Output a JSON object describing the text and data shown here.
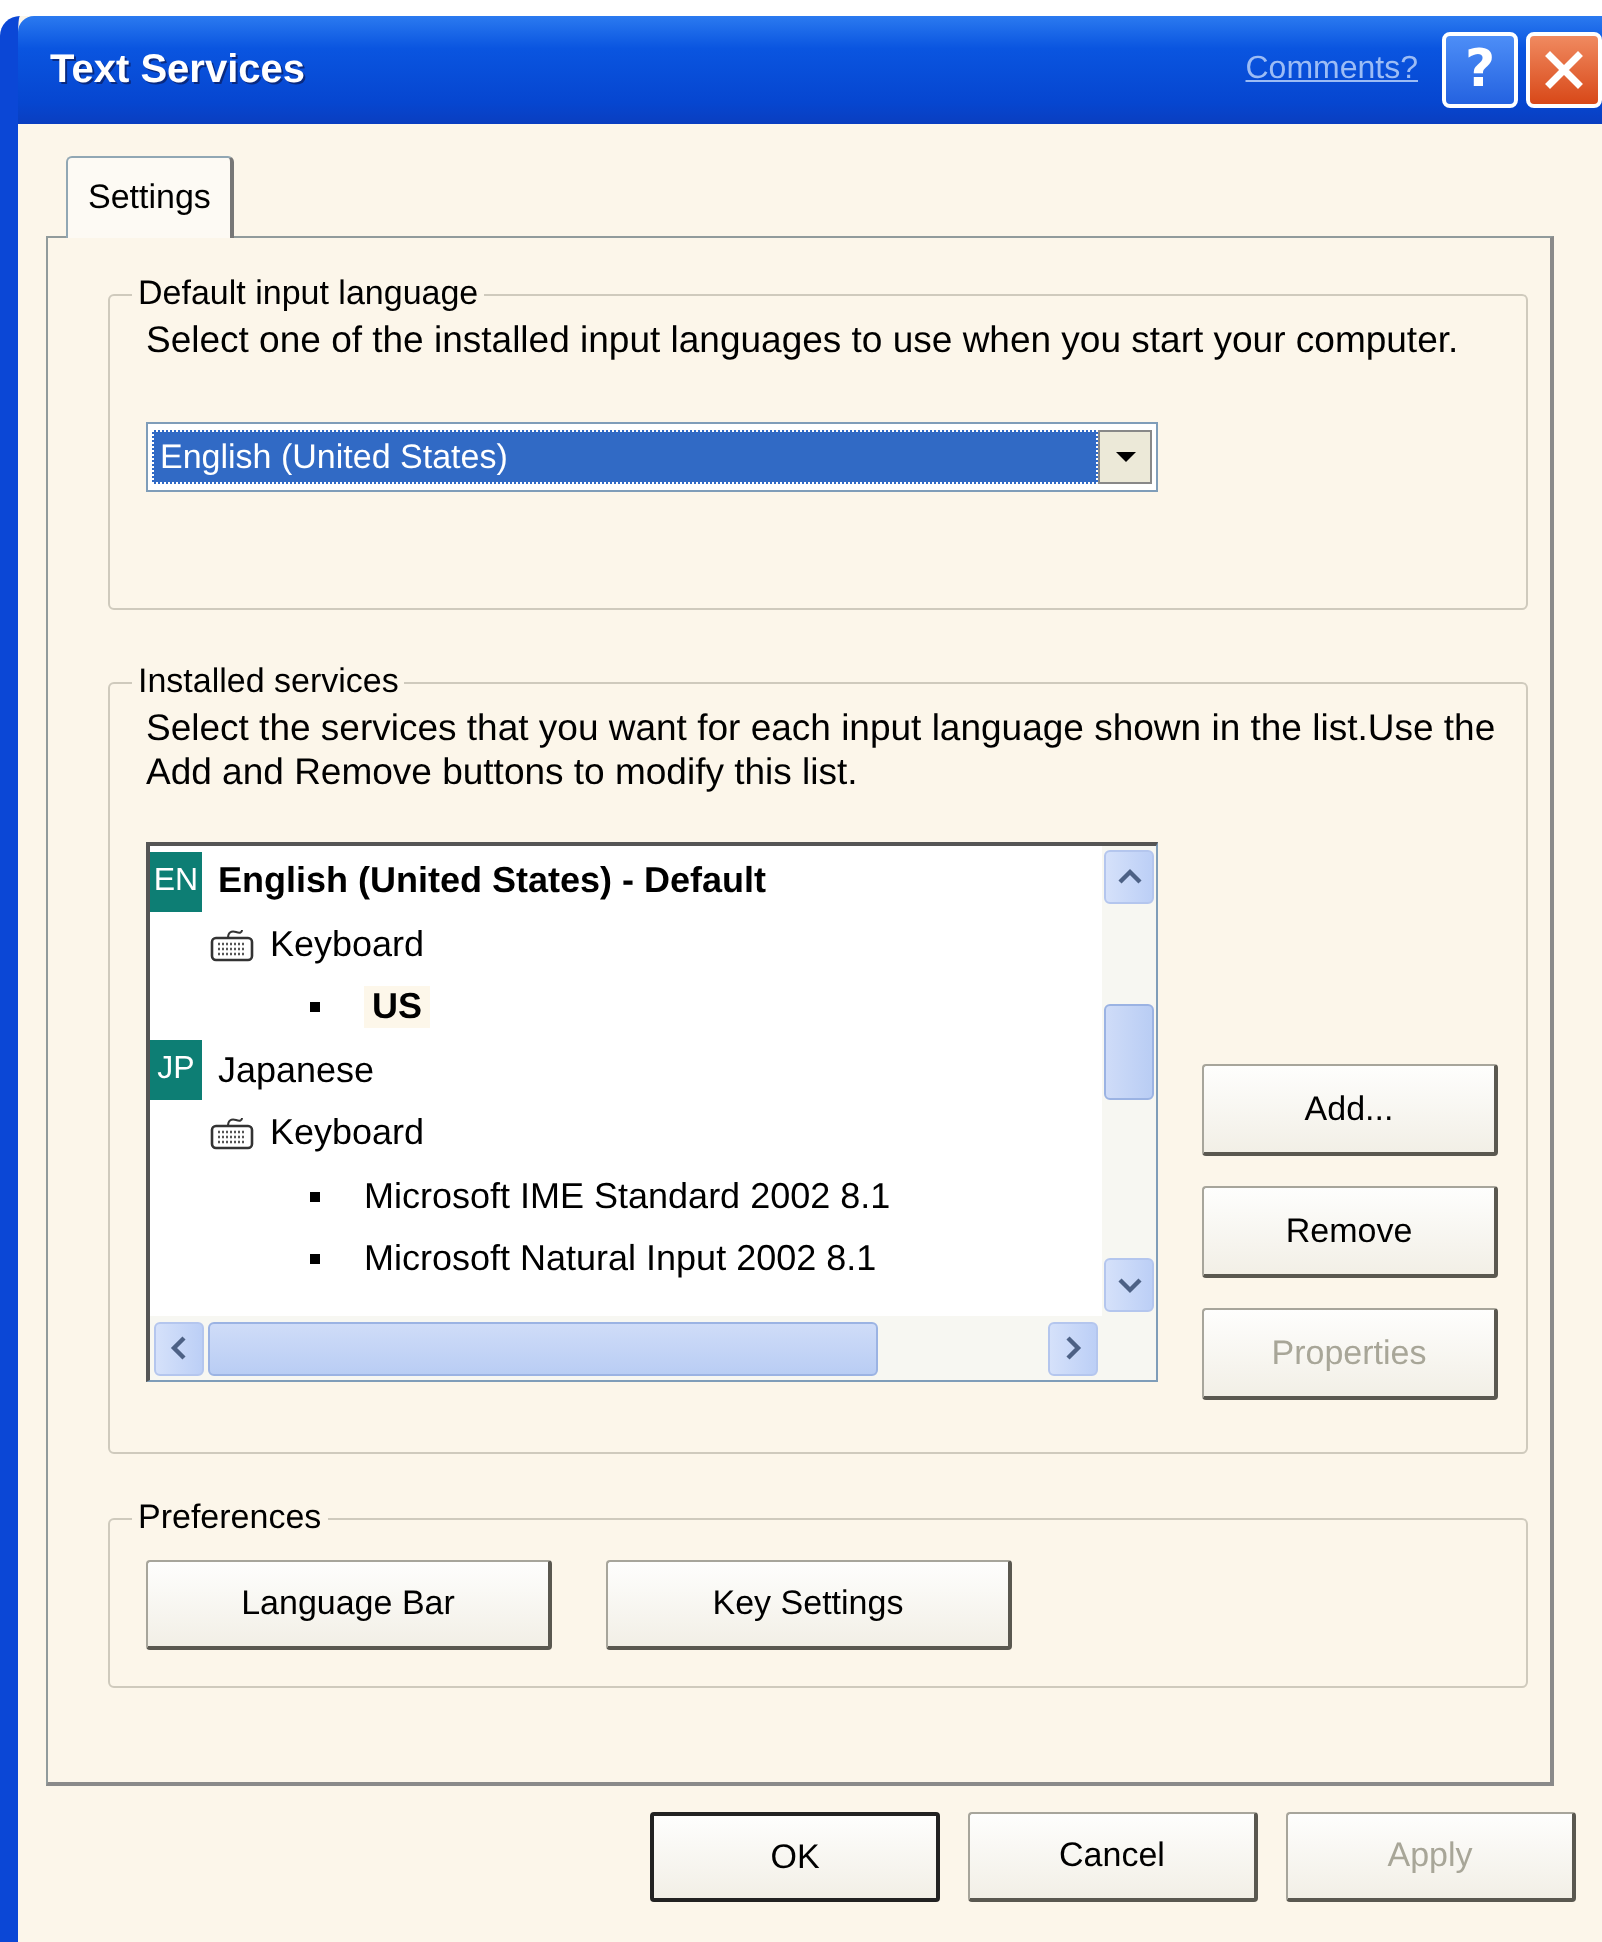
{
  "window": {
    "title": "Text Services",
    "comments_link": "Comments?",
    "help_button": "?"
  },
  "tabs": [
    {
      "label": "Settings",
      "selected": true
    }
  ],
  "default_input_language": {
    "title": "Default input language",
    "description": "Select one of the installed input languages to use when you start your computer.",
    "dropdown": {
      "value": "English (United States)",
      "focused": true
    }
  },
  "installed_services": {
    "title": "Installed services",
    "description": "Select the services that you want for each input language shown in the list.Use the Add and Remove buttons to modify this list.",
    "languages": [
      {
        "badge": "EN",
        "label": "English (United States) - Default",
        "bold": true,
        "children": [
          {
            "kind": "category",
            "label": "Keyboard",
            "bold": false,
            "children": [
              {
                "kind": "service",
                "label": "US",
                "bold": true
              }
            ]
          }
        ]
      },
      {
        "badge": "JP",
        "label": "Japanese",
        "bold": false,
        "children": [
          {
            "kind": "category",
            "label": "Keyboard",
            "bold": false,
            "children": [
              {
                "kind": "service",
                "label": "Microsoft IME Standard 2002 8.1",
                "bold": false
              },
              {
                "kind": "service",
                "label": "Microsoft Natural Input 2002 8.1",
                "bold": false
              }
            ]
          }
        ]
      }
    ],
    "buttons": [
      {
        "label": "Add...",
        "disabled": false
      },
      {
        "label": "Remove",
        "disabled": false
      },
      {
        "label": "Properties",
        "disabled": true
      }
    ]
  },
  "preferences": {
    "title": "Preferences",
    "buttons": [
      {
        "label": "Language Bar",
        "disabled": false
      },
      {
        "label": "Key Settings",
        "disabled": false
      }
    ]
  },
  "dialog_buttons": [
    {
      "label": "OK",
      "default": true,
      "disabled": false
    },
    {
      "label": "Cancel",
      "default": false,
      "disabled": false
    },
    {
      "label": "Apply",
      "default": false,
      "disabled": true
    }
  ]
}
